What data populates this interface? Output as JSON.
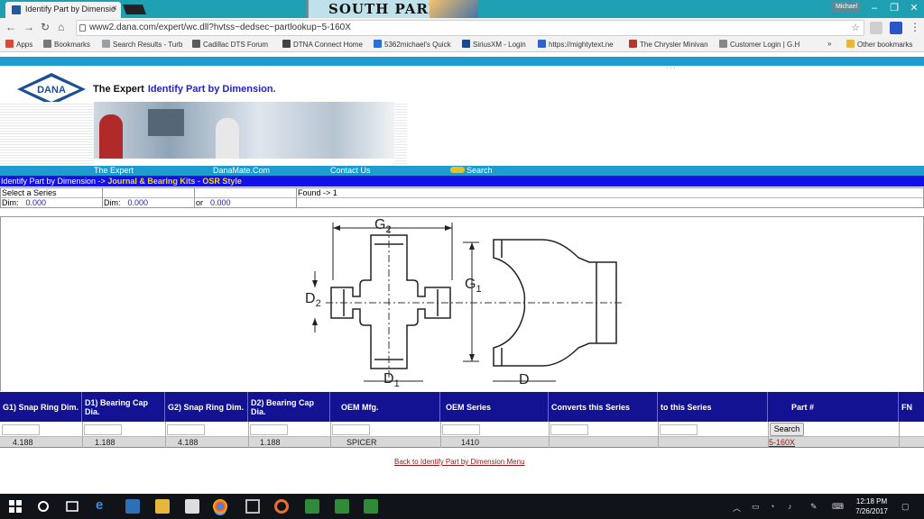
{
  "browser": {
    "tab_title": "Identify Part by Dimensio",
    "tab_close": "×",
    "banner_text": "SOUTH PARK",
    "window_user": "Michael",
    "url": "www2.dana.com/expert/wc.dll?hvtss~dedsec~partlookup~5-160X",
    "bookmarks": [
      {
        "label": "Apps",
        "color": "#d64b3b"
      },
      {
        "label": "Bookmarks",
        "color": "#777777"
      },
      {
        "label": "Search Results - Turb",
        "color": "#9aa0a6"
      },
      {
        "label": "Cadillac DTS Forum",
        "color": "#5a5a5a"
      },
      {
        "label": "DTNA Connect Home",
        "color": "#444444"
      },
      {
        "label": "5362michael's Quick",
        "color": "#2b6fd6"
      },
      {
        "label": "SiriusXM - Login",
        "color": "#1b4a8c"
      },
      {
        "label": "https://mightytext.ne",
        "color": "#3062c8"
      },
      {
        "label": "The Chrysler Minivan",
        "color": "#b03a2e"
      },
      {
        "label": "Customer Login | G.H",
        "color": "#888888"
      },
      {
        "label": "»",
        "color": ""
      },
      {
        "label": "Other bookmarks",
        "color": "#e5b93d"
      }
    ]
  },
  "page": {
    "logo_text": "DANA",
    "brand": "The Expert",
    "brand_subtitle": "Identify Part by Dimension.",
    "dots": "· · ·",
    "nav": [
      "The Expert",
      "DanaMate.Com",
      "Contact Us",
      "Search"
    ],
    "nav_new_badge": "NEW",
    "breadcrumb_prefix": "Identify Part by Dimension ->",
    "breadcrumb_current": "Journal & Bearing Kits - OSR Style",
    "filters": {
      "select_series": "Select a Series",
      "found": "Found -> 1",
      "dim1_label": "Dim:",
      "dim1_value": "0.000",
      "dim2_label": "Dim:",
      "dim2_value": "0.000",
      "or_label": "or",
      "or_value": "0.000"
    },
    "diagram_labels": {
      "g2": "G",
      "g2_sub": "2",
      "g1": "G",
      "g1_sub": "1",
      "d2": "D",
      "d2_sub": "2",
      "d1": "D",
      "d1_sub": "1",
      "d": "D"
    },
    "table": {
      "headers": [
        "G1) Snap Ring Dim.",
        "D1) Bearing Cap Dia.",
        "G2) Snap Ring Dim.",
        "D2) Bearing Cap Dia.",
        "OEM Mfg.",
        "OEM Series",
        "Converts this Series",
        "to this Series",
        "Part #",
        "FN"
      ],
      "search_button": "Search",
      "row": [
        "4.188",
        "1.188",
        "4.188",
        "1.188",
        "SPICER",
        "1410",
        "",
        "",
        "5-160X",
        ""
      ]
    },
    "back_link": "Back to Identify Part by Dimension Menu"
  },
  "taskbar": {
    "time": "12:18 PM",
    "date": "7/26/2017"
  }
}
